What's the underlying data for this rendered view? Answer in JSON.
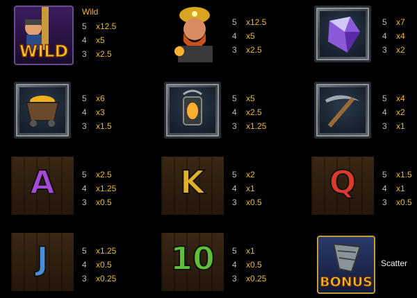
{
  "symbols": [
    {
      "name": "Wild",
      "badge": "WILD",
      "pays": [
        {
          "count": "5",
          "multiplier": "x12.5"
        },
        {
          "count": "4",
          "multiplier": "x5"
        },
        {
          "count": "3",
          "multiplier": "x2.5"
        }
      ]
    },
    {
      "name": "Miner",
      "pays": [
        {
          "count": "5",
          "multiplier": "x12.5"
        },
        {
          "count": "4",
          "multiplier": "x5"
        },
        {
          "count": "3",
          "multiplier": "x2.5"
        }
      ]
    },
    {
      "name": "Crystal",
      "pays": [
        {
          "count": "5",
          "multiplier": "x7"
        },
        {
          "count": "4",
          "multiplier": "x4"
        },
        {
          "count": "3",
          "multiplier": "x2"
        }
      ]
    },
    {
      "name": "Gold cart",
      "pays": [
        {
          "count": "5",
          "multiplier": "x6"
        },
        {
          "count": "4",
          "multiplier": "x3"
        },
        {
          "count": "3",
          "multiplier": "x1.5"
        }
      ]
    },
    {
      "name": "Lantern",
      "pays": [
        {
          "count": "5",
          "multiplier": "x5"
        },
        {
          "count": "4",
          "multiplier": "x2.5"
        },
        {
          "count": "3",
          "multiplier": "x1.25"
        }
      ]
    },
    {
      "name": "Pickaxe",
      "pays": [
        {
          "count": "5",
          "multiplier": "x4"
        },
        {
          "count": "4",
          "multiplier": "x2"
        },
        {
          "count": "3",
          "multiplier": "x1"
        }
      ]
    },
    {
      "name": "A",
      "glyph": "A",
      "pays": [
        {
          "count": "5",
          "multiplier": "x2.5"
        },
        {
          "count": "4",
          "multiplier": "x1.25"
        },
        {
          "count": "3",
          "multiplier": "x0.5"
        }
      ]
    },
    {
      "name": "K",
      "glyph": "K",
      "pays": [
        {
          "count": "5",
          "multiplier": "x2"
        },
        {
          "count": "4",
          "multiplier": "x1"
        },
        {
          "count": "3",
          "multiplier": "x0.5"
        }
      ]
    },
    {
      "name": "Q",
      "glyph": "Q",
      "pays": [
        {
          "count": "5",
          "multiplier": "x1.5"
        },
        {
          "count": "4",
          "multiplier": "x1"
        },
        {
          "count": "3",
          "multiplier": "x0.5"
        }
      ]
    },
    {
      "name": "J",
      "glyph": "J",
      "pays": [
        {
          "count": "5",
          "multiplier": "x1.25"
        },
        {
          "count": "4",
          "multiplier": "x0.5"
        },
        {
          "count": "3",
          "multiplier": "x0.25"
        }
      ]
    },
    {
      "name": "10",
      "glyph": "10",
      "pays": [
        {
          "count": "5",
          "multiplier": "x1"
        },
        {
          "count": "4",
          "multiplier": "x0.5"
        },
        {
          "count": "3",
          "multiplier": "x0.25"
        }
      ]
    },
    {
      "name": "Bonus",
      "badge": "BONUS"
    }
  ],
  "labels": {
    "wild": "Wild",
    "scatter": "Scatter"
  },
  "colors": {
    "multiplier": "#f5b81a",
    "A": "#a64ad6",
    "K": "#e0b02a",
    "Q": "#d93a2a",
    "J": "#4a8ed8",
    "10": "#5fbf3a"
  }
}
